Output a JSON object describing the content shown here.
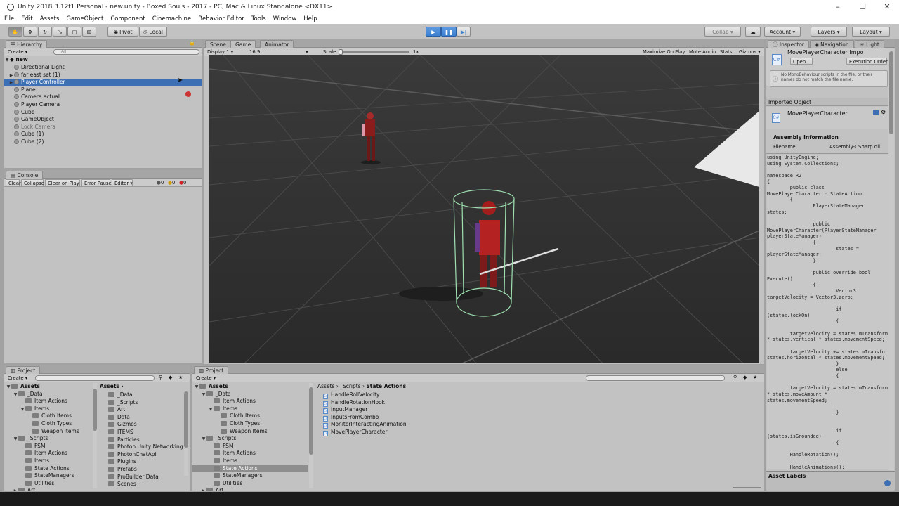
{
  "window": {
    "title": "Unity 2018.3.12f1 Personal - new.unity - Boxed Souls - 2017 - PC, Mac & Linux Standalone <DX11>",
    "minimize": "–",
    "maximize": "☐",
    "close": "✕"
  },
  "menu": [
    "File",
    "Edit",
    "Assets",
    "GameObject",
    "Component",
    "Cinemachine",
    "Behavior Editor",
    "Tools",
    "Window",
    "Help"
  ],
  "toolbar": {
    "pivot": "Pivot",
    "local": "Local",
    "collab": "Collab ▾",
    "account": "Account ▾",
    "layers": "Layers ▾",
    "layout": "Layout ▾",
    "play_state": "playing"
  },
  "hierarchy": {
    "tab": "Hierarchy",
    "create": "Create ▾",
    "search_placeholder": "All",
    "scene": "new",
    "items": [
      {
        "label": "Directional Light",
        "expandable": false,
        "selected": false,
        "dim": false
      },
      {
        "label": "far east set (1)",
        "expandable": true,
        "selected": false,
        "dim": false
      },
      {
        "label": "Player Controller",
        "expandable": true,
        "selected": true,
        "dim": false
      },
      {
        "label": "Plane",
        "expandable": false,
        "selected": false,
        "dim": false
      },
      {
        "label": "Camera actual",
        "expandable": false,
        "selected": false,
        "dim": false
      },
      {
        "label": "Player Camera",
        "expandable": false,
        "selected": false,
        "dim": false
      },
      {
        "label": "Cube",
        "expandable": false,
        "selected": false,
        "dim": false
      },
      {
        "label": "GameObject",
        "expandable": false,
        "selected": false,
        "dim": false
      },
      {
        "label": "Lock Camera",
        "expandable": false,
        "selected": false,
        "dim": true
      },
      {
        "label": "Cube (1)",
        "expandable": false,
        "selected": false,
        "dim": false
      },
      {
        "label": "Cube (2)",
        "expandable": false,
        "selected": false,
        "dim": false
      }
    ]
  },
  "console": {
    "tab": "Console",
    "buttons": [
      "Clear",
      "Collapse",
      "Clear on Play",
      "Error Pause",
      "Editor ▾"
    ],
    "counts": [
      "0",
      "0",
      "0"
    ]
  },
  "game_view": {
    "tabs": [
      "Scene",
      "Game",
      "Animator"
    ],
    "active_tab": "Game",
    "display": "Display 1",
    "aspect": "16:9",
    "scale_label": "Scale",
    "scale_value": "1x",
    "options": [
      "Maximize On Play",
      "Mute Audio",
      "Stats",
      "Gizmos ▾"
    ]
  },
  "inspector": {
    "tabs": [
      "Inspector",
      "Navigation",
      "Light"
    ],
    "asset_name": "MovePlayerCharacter Impo",
    "open_button": "Open...",
    "execution_order_button": "Execution Order...",
    "warning": "No MonoBehaviour scripts in the file, or their names do not match the file name.",
    "imported_object_header": "Imported Object",
    "imported_object_name": "MovePlayerCharacter",
    "assembly_header": "Assembly Information",
    "filename_label": "Filename",
    "filename_value": "Assembly-CSharp.dll",
    "code": [
      "using UnityEngine;",
      "using System.Collections;",
      "",
      "namespace R2",
      "{",
      "        public class",
      "MovePlayerCharacter : StateAction",
      "        {",
      "                PlayerStateManager",
      "states;",
      "",
      "                public",
      "MovePlayerCharacter(PlayerStateManager",
      "playerStateManager)",
      "                {",
      "                        states =",
      "playerStateManager;",
      "                }",
      "",
      "                public override bool",
      "Execute()",
      "                {",
      "                        Vector3",
      "targetVelocity = Vector3.zero;",
      "",
      "                        if",
      "(states.lockOn)",
      "                        {",
      "",
      "        targetVelocity = states.mTransform.forward",
      "* states.vertical * states.movementSpeed;",
      "",
      "        targetVelocity += states.mTransform.right *",
      "states.horizontal * states.movementSpeed;",
      "                        }",
      "                        else",
      "                        {",
      "",
      "        targetVelocity = states.mTransform.forward",
      "* states.moveAmount *",
      "states.movementSpeed;",
      "",
      "                        }",
      "",
      "",
      "                        if",
      "(states.isGrounded)",
      "                        {",
      "",
      "        HandleRotation();",
      "",
      "        HandleAnimations();"
    ],
    "asset_labels": "Asset Labels"
  },
  "project_left": {
    "tab": "Project",
    "create": "Create ▾",
    "tree_root": "Assets",
    "tree": [
      {
        "label": "_Data",
        "indent": 1,
        "arrow": "▼"
      },
      {
        "label": "Item Actions",
        "indent": 2,
        "arrow": ""
      },
      {
        "label": "Items",
        "indent": 2,
        "arrow": "▼"
      },
      {
        "label": "Cloth Items",
        "indent": 3,
        "arrow": ""
      },
      {
        "label": "Cloth Types",
        "indent": 3,
        "arrow": ""
      },
      {
        "label": "Weapon Items",
        "indent": 3,
        "arrow": ""
      },
      {
        "label": "_Scripts",
        "indent": 1,
        "arrow": "▼"
      },
      {
        "label": "FSM",
        "indent": 2,
        "arrow": ""
      },
      {
        "label": "Item Actions",
        "indent": 2,
        "arrow": ""
      },
      {
        "label": "Items",
        "indent": 2,
        "arrow": ""
      },
      {
        "label": "State Actions",
        "indent": 2,
        "arrow": ""
      },
      {
        "label": "StateManagers",
        "indent": 2,
        "arrow": ""
      },
      {
        "label": "Utilities",
        "indent": 2,
        "arrow": ""
      },
      {
        "label": "Art",
        "indent": 1,
        "arrow": "▶"
      }
    ],
    "breadcrumb": "Assets",
    "folders": [
      "_Data",
      "_Scripts",
      "Art",
      "Data",
      "Gizmos",
      "ITEMS",
      "Particles",
      "Photon Unity Networking",
      "PhotonChatApi",
      "Plugins",
      "Prefabs",
      "ProBuilder Data",
      "Scenes"
    ]
  },
  "project_right": {
    "tab": "Project",
    "create": "Create ▾",
    "tree_root": "Assets",
    "tree": [
      {
        "label": "_Data",
        "indent": 1,
        "arrow": "▼",
        "selected": false
      },
      {
        "label": "Item Actions",
        "indent": 2,
        "arrow": "",
        "selected": false
      },
      {
        "label": "Items",
        "indent": 2,
        "arrow": "▼",
        "selected": false
      },
      {
        "label": "Cloth Items",
        "indent": 3,
        "arrow": "",
        "selected": false
      },
      {
        "label": "Cloth Types",
        "indent": 3,
        "arrow": "",
        "selected": false
      },
      {
        "label": "Weapon Items",
        "indent": 3,
        "arrow": "",
        "selected": false
      },
      {
        "label": "_Scripts",
        "indent": 1,
        "arrow": "▼",
        "selected": false
      },
      {
        "label": "FSM",
        "indent": 2,
        "arrow": "",
        "selected": false
      },
      {
        "label": "Item Actions",
        "indent": 2,
        "arrow": "",
        "selected": false
      },
      {
        "label": "Items",
        "indent": 2,
        "arrow": "",
        "selected": false
      },
      {
        "label": "State Actions",
        "indent": 2,
        "arrow": "",
        "selected": true
      },
      {
        "label": "StateManagers",
        "indent": 2,
        "arrow": "",
        "selected": false
      },
      {
        "label": "Utilities",
        "indent": 2,
        "arrow": "",
        "selected": false
      },
      {
        "label": "Art",
        "indent": 1,
        "arrow": "▶",
        "selected": false
      }
    ],
    "breadcrumb": [
      "Assets",
      "_Scripts",
      "State Actions"
    ],
    "files": [
      "HandleRollVelocity",
      "HandleRotationHook",
      "InputManager",
      "InputsFromCombo",
      "MonitorInteractingAnimation",
      "MovePlayerCharacter"
    ]
  }
}
